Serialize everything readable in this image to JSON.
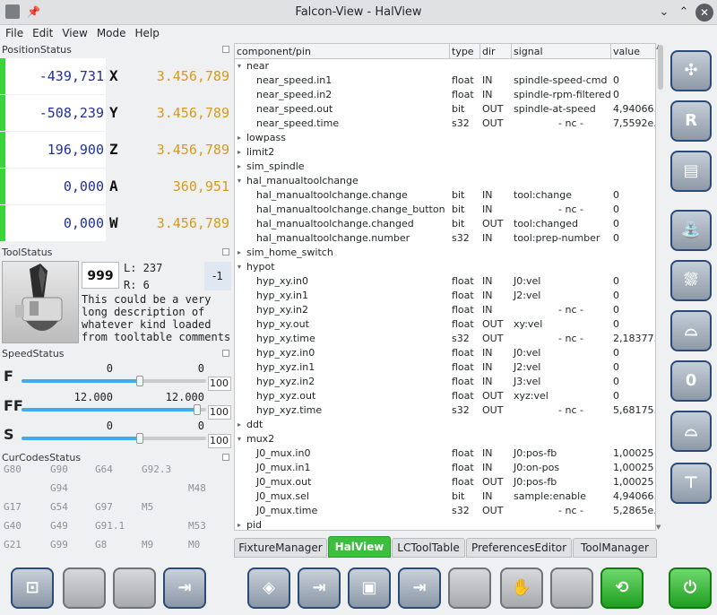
{
  "window": {
    "title": "Falcon-View - HalView"
  },
  "menu": [
    "File",
    "Edit",
    "View",
    "Mode",
    "Help"
  ],
  "position_status": {
    "header": "PositionStatus",
    "rows": [
      {
        "rel": "-439,731",
        "axis": "X",
        "abs": "3.456,789"
      },
      {
        "rel": "-508,239",
        "axis": "Y",
        "abs": "3.456,789"
      },
      {
        "rel": "196,900",
        "axis": "Z",
        "abs": "3.456,789"
      },
      {
        "rel": "0,000",
        "axis": "A",
        "abs": "360,951"
      },
      {
        "rel": "0,000",
        "axis": "W",
        "abs": "3.456,789"
      }
    ]
  },
  "tool_status": {
    "header": "ToolStatus",
    "number": "999",
    "length": "L: 237",
    "radius": "R: 6",
    "offset": "-1",
    "description": [
      "This could be a very",
      "long description of",
      "whatever kind loaded",
      "from tooltable comments"
    ]
  },
  "speed_status": {
    "header": "SpeedStatus",
    "rows": [
      {
        "label": "F",
        "current": "0",
        "target": "0",
        "percent": "100",
        "level_fraction": 0.64
      },
      {
        "label": "FF",
        "current": "12.000",
        "target": "12.000",
        "percent": "100",
        "level_fraction": 0.95
      },
      {
        "label": "S",
        "current": "0",
        "target": "0",
        "percent": "100",
        "level_fraction": 0.64
      }
    ]
  },
  "cur_codes": {
    "header": "CurCodesStatus",
    "rows": [
      [
        "G80",
        "G90",
        "G64",
        "G92.3",
        ""
      ],
      [
        "",
        "G94",
        "",
        "",
        "M48"
      ],
      [
        "G17",
        "G54",
        "G97",
        "M5",
        ""
      ],
      [
        "G40",
        "G49",
        "G91.1",
        "",
        "M53"
      ],
      [
        "G21",
        "G99",
        "G8",
        "M9",
        "M0"
      ]
    ]
  },
  "table": {
    "columns": [
      "component/pin",
      "type",
      "dir",
      "signal",
      "value"
    ],
    "rows": [
      {
        "kind": "group",
        "expanded": true,
        "name": "near"
      },
      {
        "kind": "pin",
        "name": "near_speed.in1",
        "type": "float",
        "dir": "IN",
        "signal": "spindle-speed-cmd",
        "value": "0"
      },
      {
        "kind": "pin",
        "name": "near_speed.in2",
        "type": "float",
        "dir": "IN",
        "signal": "spindle-rpm-filtered",
        "value": "0"
      },
      {
        "kind": "pin",
        "name": "near_speed.out",
        "type": "bit",
        "dir": "OUT",
        "signal": "spindle-at-speed",
        "value": "4,94066.."
      },
      {
        "kind": "pin",
        "name": "near_speed.time",
        "type": "s32",
        "dir": "OUT",
        "signal": "- nc -",
        "value": "7,5592e.."
      },
      {
        "kind": "group",
        "expanded": false,
        "name": "lowpass"
      },
      {
        "kind": "group",
        "expanded": false,
        "name": "limit2"
      },
      {
        "kind": "group",
        "expanded": false,
        "name": "sim_spindle"
      },
      {
        "kind": "group",
        "expanded": true,
        "name": "hal_manualtoolchange"
      },
      {
        "kind": "pin",
        "name": "hal_manualtoolchange.change",
        "type": "bit",
        "dir": "IN",
        "signal": "tool:change",
        "value": "0"
      },
      {
        "kind": "pin",
        "name": "hal_manualtoolchange.change_button",
        "type": "bit",
        "dir": "IN",
        "signal": "- nc -",
        "value": "0"
      },
      {
        "kind": "pin",
        "name": "hal_manualtoolchange.changed",
        "type": "bit",
        "dir": "OUT",
        "signal": "tool:changed",
        "value": "0"
      },
      {
        "kind": "pin",
        "name": "hal_manualtoolchange.number",
        "type": "s32",
        "dir": "IN",
        "signal": "tool:prep-number",
        "value": "0"
      },
      {
        "kind": "group",
        "expanded": false,
        "name": "sim_home_switch"
      },
      {
        "kind": "group",
        "expanded": true,
        "name": "hypot"
      },
      {
        "kind": "pin",
        "name": "hyp_xy.in0",
        "type": "float",
        "dir": "IN",
        "signal": "J0:vel",
        "value": "0"
      },
      {
        "kind": "pin",
        "name": "hyp_xy.in1",
        "type": "float",
        "dir": "IN",
        "signal": "J2:vel",
        "value": "0"
      },
      {
        "kind": "pin",
        "name": "hyp_xy.in2",
        "type": "float",
        "dir": "IN",
        "signal": "- nc -",
        "value": "0"
      },
      {
        "kind": "pin",
        "name": "hyp_xy.out",
        "type": "float",
        "dir": "OUT",
        "signal": "xy:vel",
        "value": "0"
      },
      {
        "kind": "pin",
        "name": "hyp_xy.time",
        "type": "s32",
        "dir": "OUT",
        "signal": "- nc -",
        "value": "2,18377.."
      },
      {
        "kind": "pin",
        "name": "hyp_xyz.in0",
        "type": "float",
        "dir": "IN",
        "signal": "J0:vel",
        "value": "0"
      },
      {
        "kind": "pin",
        "name": "hyp_xyz.in1",
        "type": "float",
        "dir": "IN",
        "signal": "J2:vel",
        "value": "0"
      },
      {
        "kind": "pin",
        "name": "hyp_xyz.in2",
        "type": "float",
        "dir": "IN",
        "signal": "J3:vel",
        "value": "0"
      },
      {
        "kind": "pin",
        "name": "hyp_xyz.out",
        "type": "float",
        "dir": "OUT",
        "signal": "xyz:vel",
        "value": "0"
      },
      {
        "kind": "pin",
        "name": "hyp_xyz.time",
        "type": "s32",
        "dir": "OUT",
        "signal": "- nc -",
        "value": "5,68175.."
      },
      {
        "kind": "group",
        "expanded": false,
        "name": "ddt"
      },
      {
        "kind": "group",
        "expanded": true,
        "name": "mux2"
      },
      {
        "kind": "pin",
        "name": "J0_mux.in0",
        "type": "float",
        "dir": "IN",
        "signal": "J0:pos-fb",
        "value": "1,00025"
      },
      {
        "kind": "pin",
        "name": "J0_mux.in1",
        "type": "float",
        "dir": "IN",
        "signal": "J0:on-pos",
        "value": "1,00025"
      },
      {
        "kind": "pin",
        "name": "J0_mux.out",
        "type": "float",
        "dir": "OUT",
        "signal": "J0:pos-fb",
        "value": "1,00025"
      },
      {
        "kind": "pin",
        "name": "J0_mux.sel",
        "type": "bit",
        "dir": "IN",
        "signal": "sample:enable",
        "value": "4,94066.."
      },
      {
        "kind": "pin",
        "name": "J0_mux.time",
        "type": "s32",
        "dir": "OUT",
        "signal": "- nc -",
        "value": "5,2865e.."
      },
      {
        "kind": "group",
        "expanded": false,
        "name": "pid"
      }
    ]
  },
  "tabs": [
    {
      "label": "FixtureManager",
      "active": false
    },
    {
      "label": "HalView",
      "active": true
    },
    {
      "label": "LCToolTable",
      "active": false
    },
    {
      "label": "PreferencesEditor",
      "active": false
    },
    {
      "label": "ToolManager",
      "active": false
    }
  ],
  "right_buttons": [
    {
      "icon": "center-arrows-icon"
    },
    {
      "icon": "reference-r-icon"
    },
    {
      "icon": "file-open-icon"
    },
    {
      "icon": "coolant-flood-icon"
    },
    {
      "icon": "coolant-mist-icon"
    },
    {
      "icon": "probe-icon"
    },
    {
      "icon": "probe-zero-icon",
      "label": "0"
    },
    {
      "icon": "probe-tool-icon"
    },
    {
      "icon": "tool-change-icon"
    }
  ],
  "bottom_buttons": [
    {
      "icon": "edit-file-icon",
      "style": "blue"
    },
    {
      "icon": "blank",
      "style": "plain"
    },
    {
      "icon": "blank",
      "style": "plain"
    },
    {
      "icon": "step-icon",
      "style": "blue"
    },
    {
      "icon": "run-from-line-icon",
      "style": "blue"
    },
    {
      "icon": "run-icon",
      "style": "blue"
    },
    {
      "icon": "single-step-icon",
      "style": "blue"
    },
    {
      "icon": "pause-icon",
      "style": "blue"
    },
    {
      "icon": "blank",
      "style": "plain"
    },
    {
      "icon": "stop-hand-icon",
      "style": "plain"
    },
    {
      "icon": "blank",
      "style": "plain"
    },
    {
      "icon": "reload-file-icon",
      "style": "green"
    },
    {
      "icon": "power-icon",
      "style": "green"
    }
  ],
  "colors": {
    "active_tab": "#3cbf3c",
    "position_bar": "#3bd43b",
    "rel_value": "#1f2fa0",
    "abs_value": "#d89a1a",
    "button_border": "#2c4a78"
  }
}
